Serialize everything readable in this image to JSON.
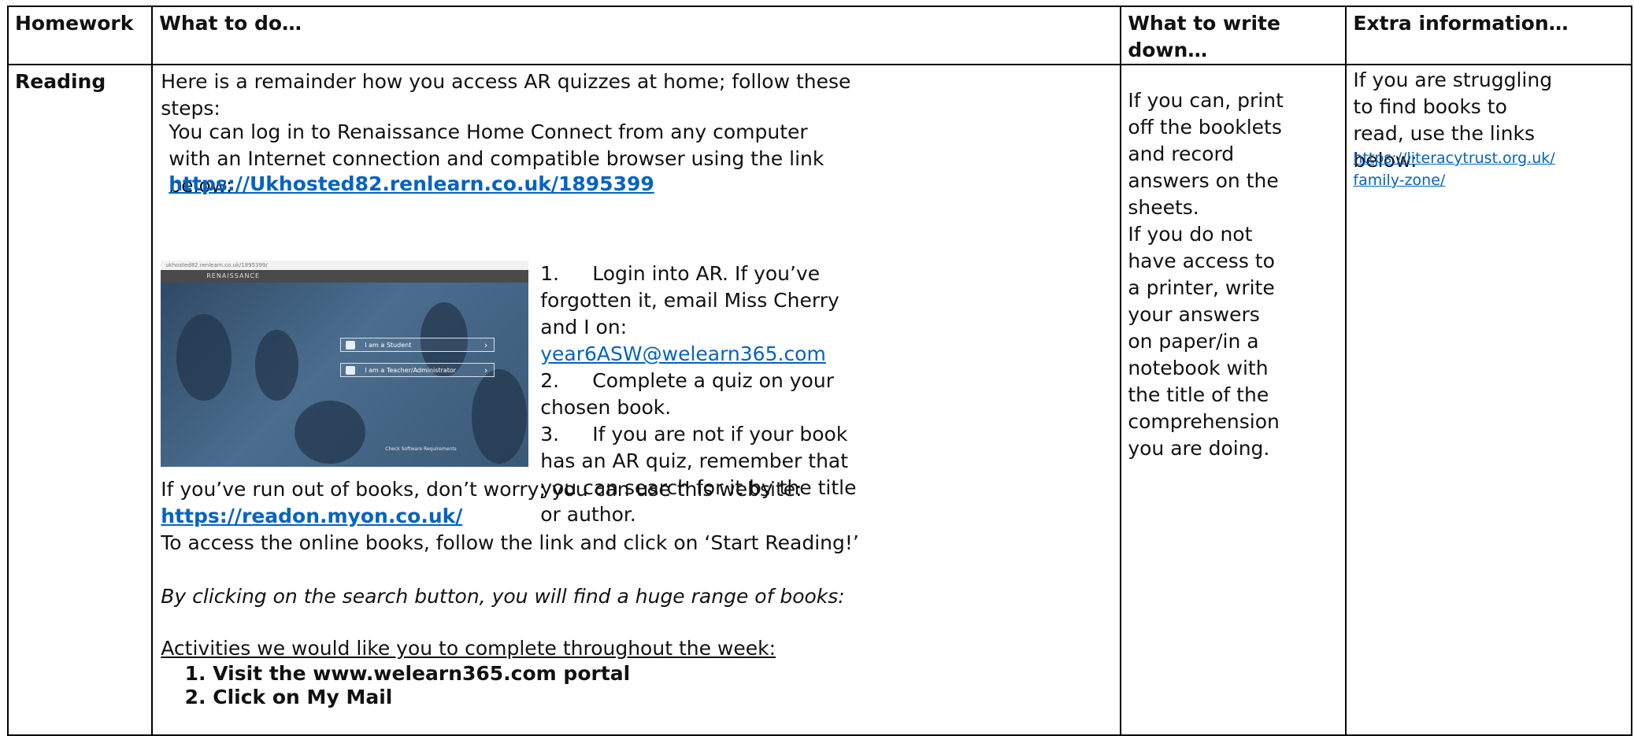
{
  "headers": {
    "homework": "Homework",
    "what_to_do": "What to do…",
    "what_to_write": "What to write down…",
    "extra_info": "Extra information…"
  },
  "row": {
    "label": "Reading",
    "intro": "Here is a remainder how you access AR quizzes at home; follow these steps:",
    "login_text": "You can log in to Renaissance Home Connect from any computer with an Internet connection and compatible browser using the link below:",
    "login_link": "https://Ukhosted82.renlearn.co.uk/1895399",
    "screenshot": {
      "url_bar": "ukhosted82.renlearn.co.uk/1895399/",
      "brand": "RENAISSANCE",
      "student_button": "I am a Student",
      "teacher_button": "I am a Teacher/Administrator",
      "requirements": "Check Software Requirements"
    },
    "steps": {
      "s1_num": "1.",
      "s1_text": "Login into AR. If you’ve forgotten it, email Miss Cherry and I on: ",
      "s1_email": "year6ASW@welearn365.com",
      "s2_num": "2.",
      "s2_text": "Complete a quiz on your chosen book.",
      "s3_num": "3.",
      "s3_text": "If you are not if your book has an AR quiz, remember that you can search for it by the title or author."
    },
    "out_of_books": "If you’ve run out of books, don’t worry; you can use this website:",
    "myon_link": "https://readon.myon.co.uk/",
    "access_text": "To access the online books, follow the link and click on ‘Start Reading!’",
    "search_text": "By clicking on the search button, you will find a huge range of books:",
    "activities_heading": "Activities we would like you to complete throughout the week:",
    "activities": [
      "Visit the www.welearn365.com portal",
      "Click on My Mail"
    ],
    "write_1": "If you can, print off the booklets and record answers on the sheets.",
    "write_2": "If you do not have access to a printer, write your answers on paper/in a notebook with the title of the comprehension you are doing.",
    "extra_text": "If you are struggling to find books to read, use the links below:",
    "extra_link": "https://literacytrust.org.uk/family-zone/"
  }
}
